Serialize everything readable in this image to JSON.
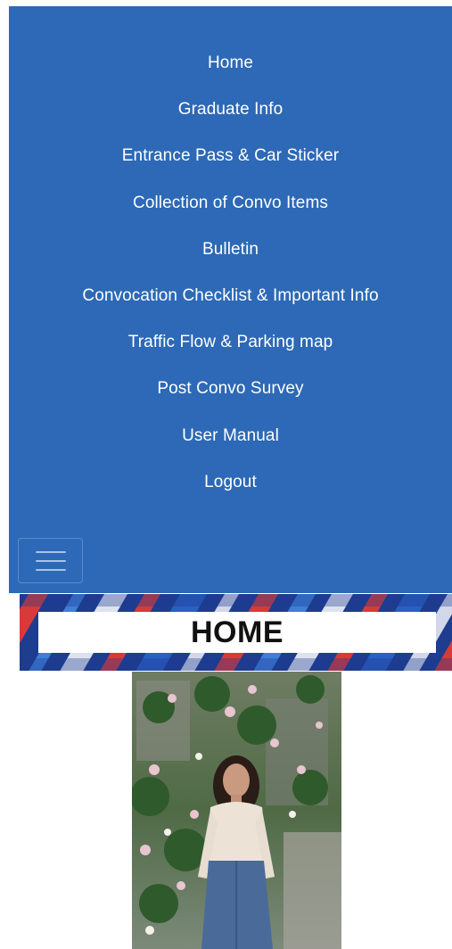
{
  "nav": {
    "items": [
      {
        "label": "Home"
      },
      {
        "label": "Graduate Info"
      },
      {
        "label": "Entrance Pass & Car Sticker"
      },
      {
        "label": "Collection of Convo Items"
      },
      {
        "label": "Bulletin"
      },
      {
        "label": "Convocation Checklist & Important Info"
      },
      {
        "label": "Traffic Flow & Parking map"
      },
      {
        "label": "Post Convo Survey"
      },
      {
        "label": "User Manual"
      },
      {
        "label": "Logout"
      }
    ],
    "toggler_icon": "hamburger-icon"
  },
  "banner": {
    "title": "HOME"
  },
  "colors": {
    "nav_bg": "#2d69b6",
    "nav_text": "#ffffff",
    "banner_blue": "#1e3d8f",
    "banner_red": "#d83a3a"
  }
}
